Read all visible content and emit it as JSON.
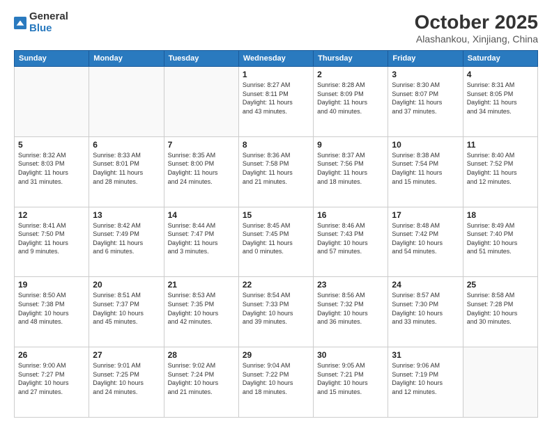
{
  "logo": {
    "general": "General",
    "blue": "Blue"
  },
  "header": {
    "month": "October 2025",
    "location": "Alashankou, Xinjiang, China"
  },
  "weekdays": [
    "Sunday",
    "Monday",
    "Tuesday",
    "Wednesday",
    "Thursday",
    "Friday",
    "Saturday"
  ],
  "weeks": [
    [
      {
        "day": "",
        "info": ""
      },
      {
        "day": "",
        "info": ""
      },
      {
        "day": "",
        "info": ""
      },
      {
        "day": "1",
        "info": "Sunrise: 8:27 AM\nSunset: 8:11 PM\nDaylight: 11 hours\nand 43 minutes."
      },
      {
        "day": "2",
        "info": "Sunrise: 8:28 AM\nSunset: 8:09 PM\nDaylight: 11 hours\nand 40 minutes."
      },
      {
        "day": "3",
        "info": "Sunrise: 8:30 AM\nSunset: 8:07 PM\nDaylight: 11 hours\nand 37 minutes."
      },
      {
        "day": "4",
        "info": "Sunrise: 8:31 AM\nSunset: 8:05 PM\nDaylight: 11 hours\nand 34 minutes."
      }
    ],
    [
      {
        "day": "5",
        "info": "Sunrise: 8:32 AM\nSunset: 8:03 PM\nDaylight: 11 hours\nand 31 minutes."
      },
      {
        "day": "6",
        "info": "Sunrise: 8:33 AM\nSunset: 8:01 PM\nDaylight: 11 hours\nand 28 minutes."
      },
      {
        "day": "7",
        "info": "Sunrise: 8:35 AM\nSunset: 8:00 PM\nDaylight: 11 hours\nand 24 minutes."
      },
      {
        "day": "8",
        "info": "Sunrise: 8:36 AM\nSunset: 7:58 PM\nDaylight: 11 hours\nand 21 minutes."
      },
      {
        "day": "9",
        "info": "Sunrise: 8:37 AM\nSunset: 7:56 PM\nDaylight: 11 hours\nand 18 minutes."
      },
      {
        "day": "10",
        "info": "Sunrise: 8:38 AM\nSunset: 7:54 PM\nDaylight: 11 hours\nand 15 minutes."
      },
      {
        "day": "11",
        "info": "Sunrise: 8:40 AM\nSunset: 7:52 PM\nDaylight: 11 hours\nand 12 minutes."
      }
    ],
    [
      {
        "day": "12",
        "info": "Sunrise: 8:41 AM\nSunset: 7:50 PM\nDaylight: 11 hours\nand 9 minutes."
      },
      {
        "day": "13",
        "info": "Sunrise: 8:42 AM\nSunset: 7:49 PM\nDaylight: 11 hours\nand 6 minutes."
      },
      {
        "day": "14",
        "info": "Sunrise: 8:44 AM\nSunset: 7:47 PM\nDaylight: 11 hours\nand 3 minutes."
      },
      {
        "day": "15",
        "info": "Sunrise: 8:45 AM\nSunset: 7:45 PM\nDaylight: 11 hours\nand 0 minutes."
      },
      {
        "day": "16",
        "info": "Sunrise: 8:46 AM\nSunset: 7:43 PM\nDaylight: 10 hours\nand 57 minutes."
      },
      {
        "day": "17",
        "info": "Sunrise: 8:48 AM\nSunset: 7:42 PM\nDaylight: 10 hours\nand 54 minutes."
      },
      {
        "day": "18",
        "info": "Sunrise: 8:49 AM\nSunset: 7:40 PM\nDaylight: 10 hours\nand 51 minutes."
      }
    ],
    [
      {
        "day": "19",
        "info": "Sunrise: 8:50 AM\nSunset: 7:38 PM\nDaylight: 10 hours\nand 48 minutes."
      },
      {
        "day": "20",
        "info": "Sunrise: 8:51 AM\nSunset: 7:37 PM\nDaylight: 10 hours\nand 45 minutes."
      },
      {
        "day": "21",
        "info": "Sunrise: 8:53 AM\nSunset: 7:35 PM\nDaylight: 10 hours\nand 42 minutes."
      },
      {
        "day": "22",
        "info": "Sunrise: 8:54 AM\nSunset: 7:33 PM\nDaylight: 10 hours\nand 39 minutes."
      },
      {
        "day": "23",
        "info": "Sunrise: 8:56 AM\nSunset: 7:32 PM\nDaylight: 10 hours\nand 36 minutes."
      },
      {
        "day": "24",
        "info": "Sunrise: 8:57 AM\nSunset: 7:30 PM\nDaylight: 10 hours\nand 33 minutes."
      },
      {
        "day": "25",
        "info": "Sunrise: 8:58 AM\nSunset: 7:28 PM\nDaylight: 10 hours\nand 30 minutes."
      }
    ],
    [
      {
        "day": "26",
        "info": "Sunrise: 9:00 AM\nSunset: 7:27 PM\nDaylight: 10 hours\nand 27 minutes."
      },
      {
        "day": "27",
        "info": "Sunrise: 9:01 AM\nSunset: 7:25 PM\nDaylight: 10 hours\nand 24 minutes."
      },
      {
        "day": "28",
        "info": "Sunrise: 9:02 AM\nSunset: 7:24 PM\nDaylight: 10 hours\nand 21 minutes."
      },
      {
        "day": "29",
        "info": "Sunrise: 9:04 AM\nSunset: 7:22 PM\nDaylight: 10 hours\nand 18 minutes."
      },
      {
        "day": "30",
        "info": "Sunrise: 9:05 AM\nSunset: 7:21 PM\nDaylight: 10 hours\nand 15 minutes."
      },
      {
        "day": "31",
        "info": "Sunrise: 9:06 AM\nSunset: 7:19 PM\nDaylight: 10 hours\nand 12 minutes."
      },
      {
        "day": "",
        "info": ""
      }
    ]
  ]
}
